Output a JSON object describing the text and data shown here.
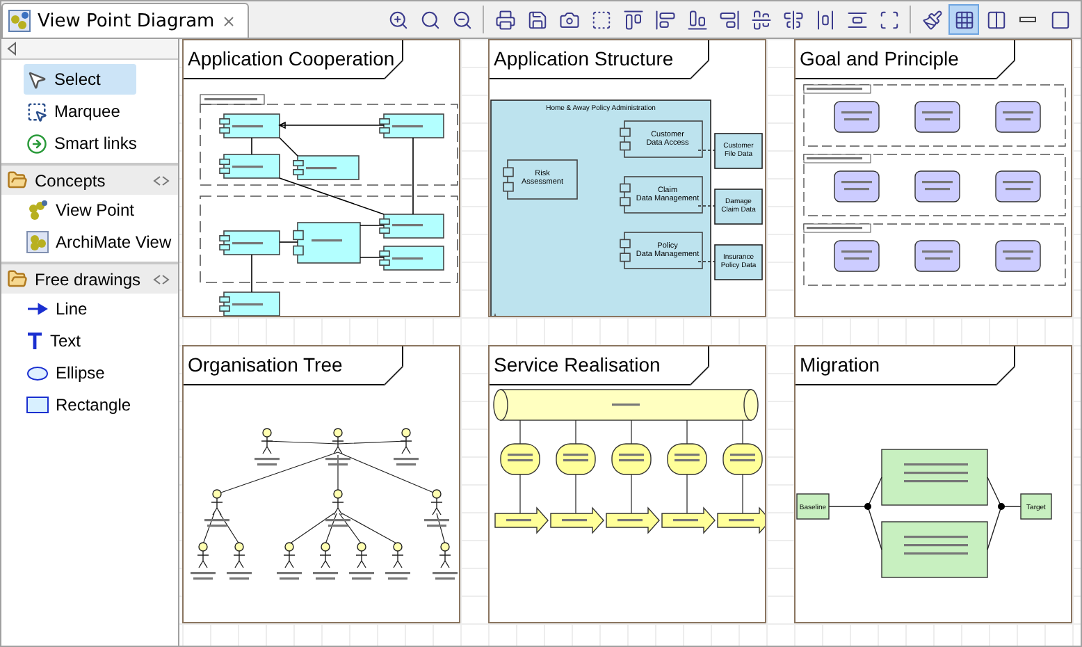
{
  "editor_tab": {
    "title": "View Point Diagram",
    "selected": true
  },
  "toolbar_buttons": [
    {
      "selected": false
    },
    {
      "selected": false
    },
    {
      "selected": false
    },
    {
      "selected": false
    },
    {
      "selected": false
    },
    {
      "selected": false
    },
    {
      "selected": false
    },
    {
      "selected": false
    },
    {
      "selected": false
    },
    {
      "selected": false
    },
    {
      "selected": false
    },
    {
      "selected": false
    },
    {
      "selected": false
    },
    {
      "selected": false
    },
    {
      "selected": false
    },
    {
      "selected": false
    },
    {
      "selected": false
    },
    {
      "selected": true
    },
    {
      "selected": false
    },
    {
      "selected": false
    },
    {
      "selected": false
    }
  ],
  "palette": {
    "tools": [
      {
        "label": "Select",
        "selected": true
      },
      {
        "label": "Marquee",
        "selected": false
      },
      {
        "label": "Smart links",
        "selected": false
      }
    ],
    "drawers": [
      {
        "title": "Concepts",
        "items": [
          {
            "label": "View Point",
            "selected": false
          },
          {
            "label": "ArchiMate View",
            "selected": false
          }
        ]
      },
      {
        "title": "Free drawings",
        "items": [
          {
            "label": "Line",
            "selected": false
          },
          {
            "label": "Text",
            "selected": false
          },
          {
            "label": "Ellipse",
            "selected": false
          },
          {
            "label": "Rectangle",
            "selected": false
          }
        ]
      }
    ]
  },
  "diagrams": [
    {
      "title": "Application Cooperation",
      "kind": "cooperation"
    },
    {
      "title": "Application Structure",
      "kind": "structure",
      "container": "Home & Away Policy Administration",
      "components": [
        "Risk Assessment",
        "Customer Data Access",
        "Claim Data Management",
        "Policy Data Management"
      ],
      "data_objects": [
        "Customer File Data",
        "Damage Claim Data",
        "Insurance Policy Data"
      ]
    },
    {
      "title": "Goal and Principle",
      "kind": "principles"
    },
    {
      "title": "Organisation Tree",
      "kind": "tree"
    },
    {
      "title": "Service Realisation",
      "kind": "realisation"
    },
    {
      "title": "Migration",
      "kind": "migration",
      "baseline": "Baseline",
      "target": "Target"
    }
  ]
}
